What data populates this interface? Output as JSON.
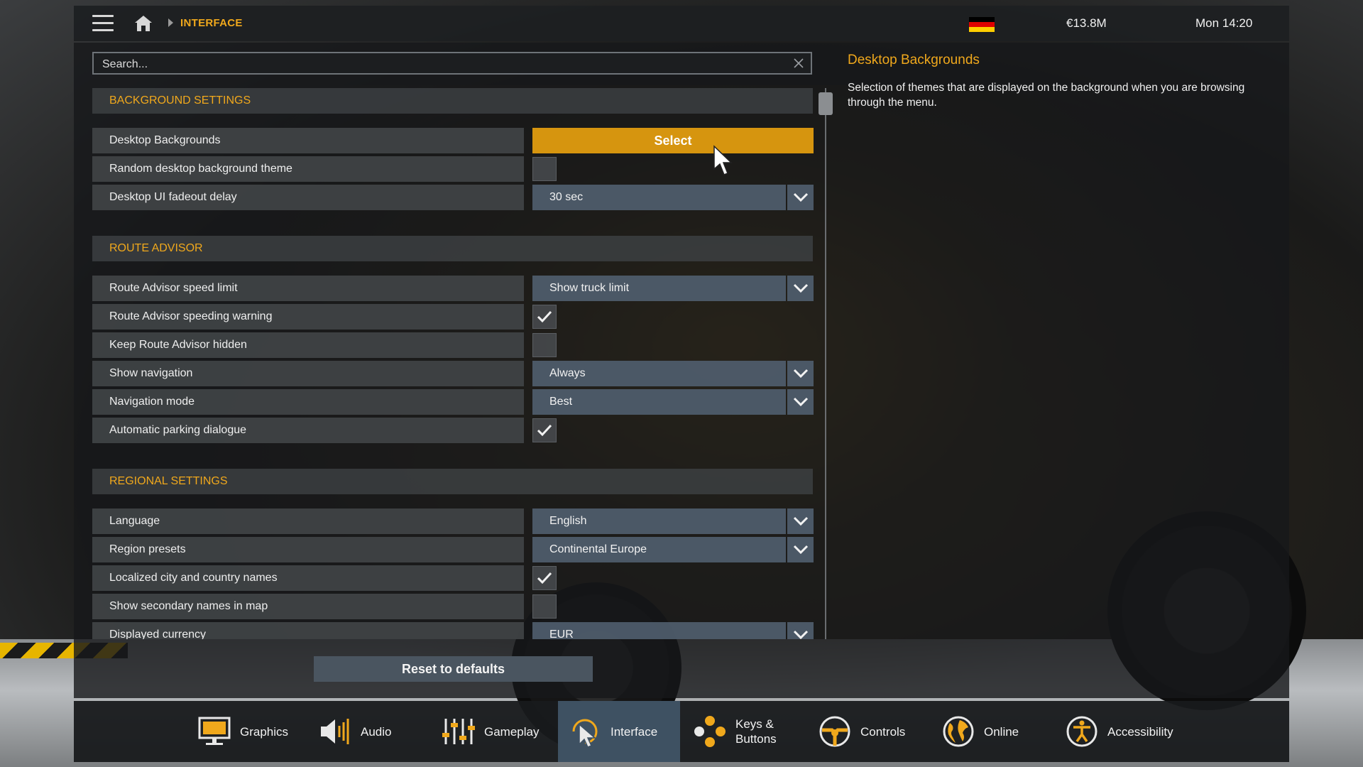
{
  "topbar": {
    "breadcrumb": "INTERFACE",
    "money": "€13.8M",
    "clock": "Mon 14:20",
    "flag_colors": [
      "#000000",
      "#dd0000",
      "#ffce00"
    ]
  },
  "search": {
    "placeholder": "Search..."
  },
  "sections": {
    "background": {
      "title": "BACKGROUND SETTINGS",
      "desktop_backgrounds": {
        "label": "Desktop Backgrounds",
        "button": "Select"
      },
      "random_theme": {
        "label": "Random desktop background theme",
        "checked": false
      },
      "fadeout_delay": {
        "label": "Desktop UI fadeout delay",
        "value": "30 sec"
      }
    },
    "route_advisor": {
      "title": "ROUTE ADVISOR",
      "speed_limit": {
        "label": "Route Advisor speed limit",
        "value": "Show truck limit"
      },
      "speeding_warning": {
        "label": "Route Advisor speeding warning",
        "checked": true
      },
      "keep_hidden": {
        "label": "Keep Route Advisor hidden",
        "checked": false
      },
      "show_navigation": {
        "label": "Show navigation",
        "value": "Always"
      },
      "navigation_mode": {
        "label": "Navigation mode",
        "value": "Best"
      },
      "parking_dialogue": {
        "label": "Automatic parking dialogue",
        "checked": true
      }
    },
    "regional": {
      "title": "REGIONAL SETTINGS",
      "language": {
        "label": "Language",
        "value": "English"
      },
      "region_presets": {
        "label": "Region presets",
        "value": "Continental Europe"
      },
      "localized_names": {
        "label": "Localized city and country names",
        "checked": true
      },
      "secondary_names": {
        "label": "Show secondary names in map",
        "checked": false
      },
      "currency": {
        "label": "Displayed currency",
        "value": "EUR"
      }
    }
  },
  "reset_label": "Reset to defaults",
  "help": {
    "title": "Desktop Backgrounds",
    "text": "Selection of themes that are displayed on the background when you are browsing through the menu."
  },
  "tabs": [
    {
      "label": "Graphics",
      "icon": "monitor-icon",
      "active": false
    },
    {
      "label": "Audio",
      "icon": "speaker-icon",
      "active": false
    },
    {
      "label": "Gameplay",
      "icon": "sliders-icon",
      "active": false
    },
    {
      "label": "Interface",
      "icon": "cursor-icon",
      "active": true
    },
    {
      "label": "Keys &\nButtons",
      "icon": "buttons-icon",
      "active": false
    },
    {
      "label": "Controls",
      "icon": "steering-wheel-icon",
      "active": false
    },
    {
      "label": "Online",
      "icon": "globe-icon",
      "active": false
    },
    {
      "label": "Accessibility",
      "icon": "accessibility-icon",
      "active": false
    }
  ],
  "colors": {
    "accent": "#f0a81c",
    "select_button": "#d6950f",
    "dropdown": "#4f5d6c",
    "active_tab": "#3e5162"
  }
}
